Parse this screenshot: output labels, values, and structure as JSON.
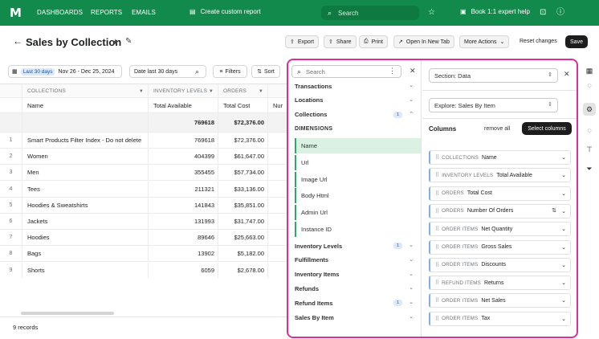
{
  "topbar": {
    "logo": "M",
    "nav": [
      "DASHBOARDS",
      "REPORTS",
      "EMAILS"
    ],
    "create_report": "Create custom report",
    "search_placeholder": "Search",
    "book_help": "Book 1:1 expert help",
    "colors": {
      "brand": "#128a4b",
      "accent_border": "#d92f9a"
    }
  },
  "title": {
    "text": "Sales by Collection",
    "buttons": {
      "export": "Export",
      "share": "Share",
      "print": "Print",
      "open_new_tab": "Open In New Tab",
      "more_actions": "More Actions",
      "reset": "Reset changes",
      "save": "Save"
    }
  },
  "filters": {
    "date_tag": "Last 30 days",
    "date_range": "Nov 26 - Dec 25, 2024",
    "compare": "Date last 30 days",
    "filters_label": "Filters",
    "sort_label": "Sort"
  },
  "table": {
    "group_headers": [
      "COLLECTIONS",
      "INVENTORY LEVELS",
      "ORDERS",
      ""
    ],
    "headers": [
      "Name",
      "Total Available",
      "Total Cost",
      "Nur"
    ],
    "totals": [
      "",
      "769618",
      "$72,376.00"
    ],
    "rows": [
      {
        "idx": "1",
        "name": "Smart Products Filter Index - Do not delete",
        "available": "769618",
        "cost": "$72,376.00"
      },
      {
        "idx": "2",
        "name": "Women",
        "available": "404399",
        "cost": "$61,647.00"
      },
      {
        "idx": "3",
        "name": "Men",
        "available": "355455",
        "cost": "$57,734.00"
      },
      {
        "idx": "4",
        "name": "Tees",
        "available": "211321",
        "cost": "$33,136.00"
      },
      {
        "idx": "5",
        "name": "Hoodies & Sweatshirts",
        "available": "141843",
        "cost": "$35,851.00"
      },
      {
        "idx": "6",
        "name": "Jackets",
        "available": "131993",
        "cost": "$31,747.00"
      },
      {
        "idx": "7",
        "name": "Hoodies",
        "available": "89646",
        "cost": "$25,663.00"
      },
      {
        "idx": "8",
        "name": "Bags",
        "available": "13902",
        "cost": "$5,182.00"
      },
      {
        "idx": "9",
        "name": "Shorts",
        "available": "6059",
        "cost": "$2,678.00"
      }
    ],
    "records": "9 records"
  },
  "panel": {
    "search_placeholder": "Search",
    "categories_top": [
      {
        "label": "Transactions",
        "badge": "",
        "chev": "⌄"
      },
      {
        "label": "Locations",
        "badge": "",
        "chev": "⌄"
      },
      {
        "label": "Collections",
        "badge": "1",
        "chev": "⌃"
      }
    ],
    "dimensions_title": "DIMENSIONS",
    "dimensions": [
      "Name",
      "Url",
      "Image Url",
      "Body Html",
      "Admin Url",
      "Instance ID"
    ],
    "categories_bottom": [
      {
        "label": "Inventory Levels",
        "badge": "1",
        "chev": "⌄"
      },
      {
        "label": "Fulfillments",
        "badge": "",
        "chev": "⌄"
      },
      {
        "label": "Inventory Items",
        "badge": "",
        "chev": "⌄"
      },
      {
        "label": "Refunds",
        "badge": "",
        "chev": "⌄"
      },
      {
        "label": "Refund Items",
        "badge": "1",
        "chev": "⌄"
      },
      {
        "label": "Sales By Item",
        "badge": "",
        "chev": "⌄"
      }
    ],
    "section_select": "Section: Data",
    "explore_select": "Explore: Sales By Item",
    "columns_title": "Columns",
    "remove_all": "remove all",
    "select_columns": "Select columns",
    "columns": [
      {
        "group": "COLLECTIONS",
        "name": "Name"
      },
      {
        "group": "INVENTORY LEVELS",
        "name": "Total Available"
      },
      {
        "group": "ORDERS",
        "name": "Total Cost"
      },
      {
        "group": "ORDERS",
        "name": "Number Of Orders"
      },
      {
        "group": "ORDER ITEMS",
        "name": "Net Quantity"
      },
      {
        "group": "ORDER ITEMS",
        "name": "Gross Sales"
      },
      {
        "group": "ORDER ITEMS",
        "name": "Discounts"
      },
      {
        "group": "REFUND ITEMS",
        "name": "Returns"
      },
      {
        "group": "ORDER ITEMS",
        "name": "Net Sales"
      },
      {
        "group": "ORDER ITEMS",
        "name": "Tax"
      }
    ]
  }
}
